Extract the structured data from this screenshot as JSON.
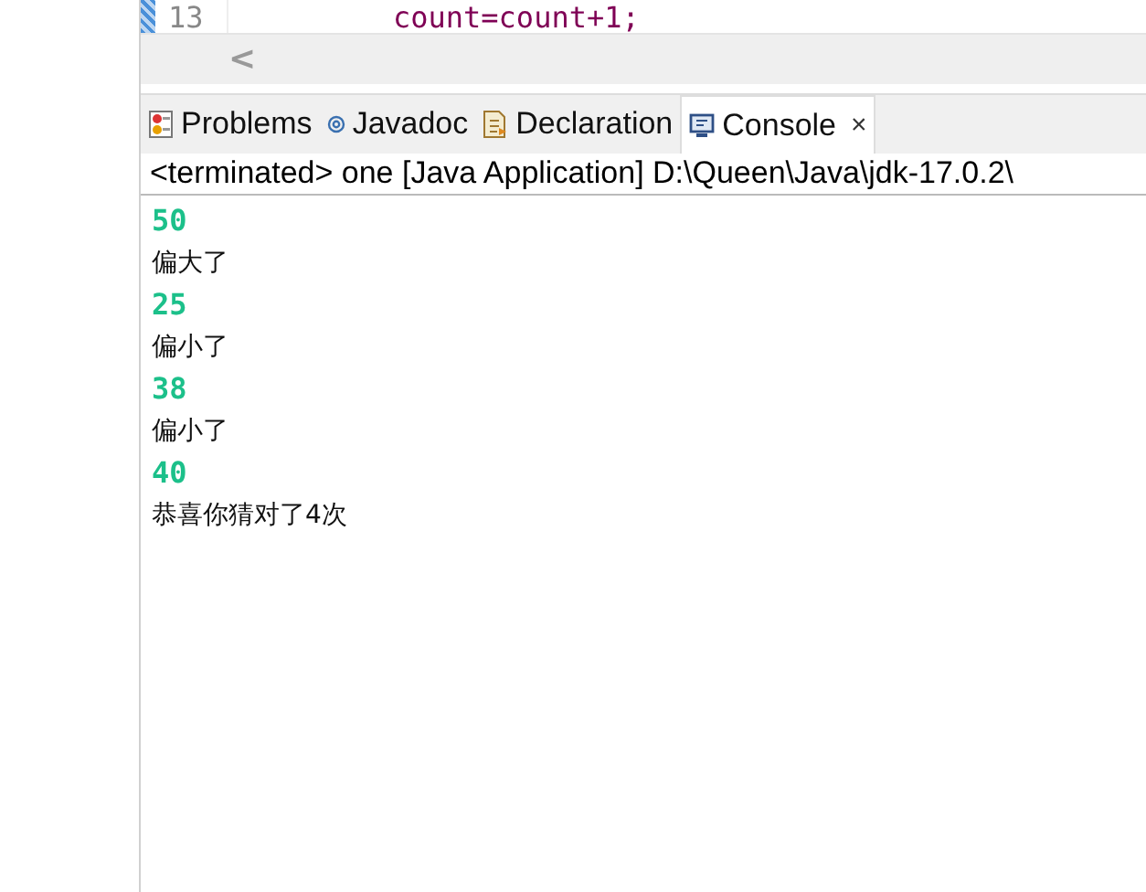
{
  "editor": {
    "line_number": "13",
    "code": "count=count+1;"
  },
  "scrollbar": {
    "left_arrow": "<"
  },
  "tabs": [
    {
      "label": "Problems",
      "kind": "problems",
      "selected": false
    },
    {
      "label": "Javadoc",
      "kind": "javadoc",
      "selected": false
    },
    {
      "label": "Declaration",
      "kind": "declaration",
      "selected": false
    },
    {
      "label": "Console",
      "kind": "console",
      "selected": true,
      "close": "×"
    }
  ],
  "console": {
    "title": "<terminated> one [Java Application] D:\\Queen\\Java\\jdk-17.0.2\\",
    "lines": [
      {
        "text": "50",
        "kind": "input"
      },
      {
        "text": "偏大了",
        "kind": "output"
      },
      {
        "text": "25",
        "kind": "input"
      },
      {
        "text": "偏小了",
        "kind": "output"
      },
      {
        "text": "38",
        "kind": "input"
      },
      {
        "text": "偏小了",
        "kind": "output"
      },
      {
        "text": "40",
        "kind": "input"
      },
      {
        "text": "恭喜你猜对了4次",
        "kind": "output"
      }
    ]
  }
}
